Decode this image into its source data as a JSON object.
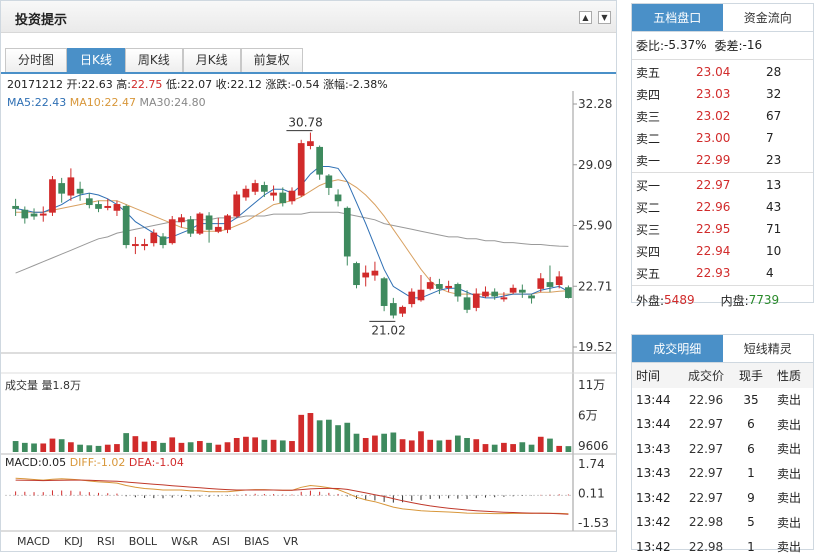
{
  "header": {
    "title": "投资提示"
  },
  "tabs": [
    "分时图",
    "日K线",
    "周K线",
    "月K线",
    "前复权"
  ],
  "info": {
    "date": "20171212",
    "open_label": "开:",
    "open": "22.63",
    "high_label": "高:",
    "high": "22.75",
    "low_label": "低:",
    "low": "22.07",
    "close_label": "收:",
    "close": "22.12",
    "change_label": "涨跌:",
    "change": "-0.54",
    "pct_label": "涨幅:",
    "pct": "-2.38%"
  },
  "ma": {
    "ma5_label": "MA5:",
    "ma5": "22.43",
    "ma10_label": "MA10:",
    "ma10": "22.47",
    "ma30_label": "MA30:",
    "ma30": "24.80"
  },
  "price_axis": [
    "32.28",
    "29.09",
    "25.90",
    "22.71",
    "19.52"
  ],
  "annotations": {
    "high": "30.78",
    "low": "21.02"
  },
  "volume": {
    "label": "成交量 量1.8万",
    "axis": [
      "11万",
      "6万",
      "9606"
    ]
  },
  "macd": {
    "macd_label": "MACD:",
    "macd": "0.05",
    "diff_label": "DIFF:",
    "diff": "-1.02",
    "dea_label": "DEA:",
    "dea": "-1.04",
    "axis": [
      "1.74",
      "0.11",
      "-1.53"
    ]
  },
  "indicators": [
    "MACD",
    "KDJ",
    "RSI",
    "BOLL",
    "W&R",
    "ASI",
    "BIAS",
    "VR"
  ],
  "chart_data": {
    "type": "candlestick",
    "ylim": [
      19.52,
      32.28
    ],
    "candles": [
      [
        26.9,
        26.8,
        27.3,
        26.4
      ],
      [
        26.7,
        26.3,
        26.9,
        26.0
      ],
      [
        26.5,
        26.4,
        26.8,
        26.2
      ],
      [
        26.5,
        26.5,
        26.9,
        26.1
      ],
      [
        26.6,
        28.3,
        28.5,
        26.4
      ],
      [
        28.1,
        27.6,
        28.4,
        27.1
      ],
      [
        27.5,
        28.4,
        28.9,
        27.2
      ],
      [
        27.8,
        27.6,
        28.2,
        27.2
      ],
      [
        27.3,
        27.0,
        27.6,
        26.8
      ],
      [
        27.0,
        26.8,
        27.2,
        26.6
      ],
      [
        26.9,
        26.9,
        27.3,
        26.7
      ],
      [
        26.7,
        27.0,
        27.2,
        26.4
      ],
      [
        26.9,
        24.9,
        27.0,
        24.7
      ],
      [
        24.9,
        24.9,
        25.3,
        24.4
      ],
      [
        24.9,
        24.9,
        25.2,
        24.6
      ],
      [
        25.0,
        25.5,
        25.7,
        24.8
      ],
      [
        25.3,
        24.9,
        25.5,
        24.7
      ],
      [
        25.0,
        26.2,
        26.4,
        24.9
      ],
      [
        26.1,
        26.3,
        26.5,
        25.8
      ],
      [
        26.2,
        25.5,
        26.4,
        25.3
      ],
      [
        25.5,
        26.5,
        26.6,
        25.4
      ],
      [
        26.4,
        25.7,
        26.6,
        25.0
      ],
      [
        25.6,
        25.8,
        26.3,
        25.5
      ],
      [
        25.7,
        26.4,
        26.5,
        25.5
      ],
      [
        26.4,
        27.5,
        27.7,
        26.3
      ],
      [
        27.4,
        27.8,
        28.0,
        27.2
      ],
      [
        27.7,
        28.1,
        28.3,
        27.5
      ],
      [
        28.0,
        27.7,
        28.2,
        27.4
      ],
      [
        27.5,
        27.6,
        28.0,
        27.2
      ],
      [
        27.6,
        27.1,
        27.9,
        26.9
      ],
      [
        27.2,
        27.7,
        27.9,
        27.0
      ],
      [
        27.5,
        30.2,
        30.4,
        27.4
      ],
      [
        30.1,
        30.3,
        30.78,
        29.9
      ],
      [
        30.0,
        28.6,
        30.1,
        28.3
      ],
      [
        28.5,
        27.9,
        28.6,
        27.5
      ],
      [
        27.5,
        27.2,
        27.8,
        26.9
      ],
      [
        26.8,
        24.3,
        26.9,
        23.8
      ],
      [
        23.9,
        22.8,
        24.0,
        22.6
      ],
      [
        23.2,
        23.4,
        23.8,
        22.7
      ],
      [
        23.3,
        23.5,
        24.0,
        23.0
      ],
      [
        23.1,
        21.7,
        23.2,
        21.4
      ],
      [
        21.8,
        21.2,
        22.1,
        21.02
      ],
      [
        21.3,
        21.6,
        21.7,
        21.1
      ],
      [
        21.8,
        22.4,
        22.6,
        21.6
      ],
      [
        22.0,
        22.5,
        23.3,
        21.9
      ],
      [
        22.6,
        22.9,
        23.2,
        22.5
      ],
      [
        22.8,
        22.6,
        23.1,
        22.3
      ],
      [
        22.7,
        22.7,
        23.0,
        22.4
      ],
      [
        22.8,
        22.2,
        22.9,
        21.9
      ],
      [
        22.1,
        21.5,
        22.5,
        21.3
      ],
      [
        21.6,
        22.3,
        22.6,
        21.4
      ],
      [
        22.2,
        22.4,
        22.7,
        22.1
      ],
      [
        22.4,
        22.2,
        22.6,
        22.0
      ],
      [
        22.1,
        22.1,
        22.4,
        21.9
      ],
      [
        22.4,
        22.6,
        22.8,
        22.3
      ],
      [
        22.5,
        22.4,
        22.8,
        22.1
      ],
      [
        22.2,
        22.1,
        22.3,
        21.8
      ],
      [
        22.6,
        23.1,
        23.4,
        22.4
      ],
      [
        22.9,
        22.7,
        23.8,
        22.4
      ],
      [
        22.8,
        23.2,
        23.5,
        22.6
      ],
      [
        22.63,
        22.12,
        22.75,
        22.07
      ]
    ],
    "volume_ylim": [
      0,
      110000
    ],
    "volume": [
      18000,
      15000,
      14000,
      14000,
      22000,
      21000,
      16000,
      12000,
      11000,
      10000,
      12000,
      13000,
      31000,
      26000,
      17000,
      18000,
      15000,
      24000,
      15000,
      16000,
      18000,
      15000,
      12000,
      16000,
      23000,
      25000,
      24000,
      20000,
      20000,
      19000,
      18000,
      61000,
      64000,
      52000,
      53000,
      44000,
      48000,
      30000,
      23000,
      27000,
      30000,
      32000,
      21000,
      19000,
      34000,
      20000,
      19000,
      20000,
      27000,
      23000,
      21000,
      13000,
      12000,
      15000,
      13000,
      16000,
      12000,
      25000,
      22000,
      10000,
      9606
    ],
    "macd_ylim": [
      -1.53,
      1.74
    ],
    "macd_hist": [
      0.22,
      0.2,
      0.18,
      0.18,
      0.28,
      0.27,
      0.26,
      0.22,
      0.18,
      0.14,
      0.12,
      0.1,
      -0.05,
      -0.1,
      -0.14,
      -0.15,
      -0.16,
      -0.12,
      -0.1,
      -0.12,
      -0.08,
      -0.08,
      -0.06,
      -0.03,
      0.04,
      0.07,
      0.09,
      0.08,
      0.07,
      0.05,
      0.05,
      0.2,
      0.26,
      0.2,
      0.14,
      0.08,
      -0.06,
      -0.2,
      -0.26,
      -0.28,
      -0.36,
      -0.4,
      -0.38,
      -0.3,
      -0.25,
      -0.2,
      -0.18,
      -0.16,
      -0.18,
      -0.2,
      -0.15,
      -0.12,
      -0.1,
      -0.08,
      -0.05,
      -0.03,
      -0.02,
      0.03,
      0.04,
      0.06,
      0.05
    ],
    "diff": [
      0.95,
      0.92,
      0.88,
      0.85,
      0.9,
      0.92,
      0.9,
      0.86,
      0.8,
      0.75,
      0.72,
      0.68,
      0.55,
      0.45,
      0.38,
      0.35,
      0.3,
      0.3,
      0.3,
      0.25,
      0.25,
      0.2,
      0.2,
      0.2,
      0.25,
      0.3,
      0.32,
      0.32,
      0.3,
      0.28,
      0.28,
      0.45,
      0.55,
      0.5,
      0.42,
      0.32,
      0.12,
      -0.1,
      -0.25,
      -0.35,
      -0.5,
      -0.65,
      -0.75,
      -0.8,
      -0.85,
      -0.88,
      -0.9,
      -0.92,
      -0.95,
      -0.98,
      -0.99,
      -1.0,
      -1.01,
      -1.01,
      -1.0,
      -1.0,
      -1.0,
      -0.98,
      -0.99,
      -1.0,
      -1.02
    ],
    "dea": [
      0.85,
      0.84,
      0.83,
      0.82,
      0.83,
      0.84,
      0.85,
      0.85,
      0.84,
      0.82,
      0.8,
      0.78,
      0.74,
      0.7,
      0.66,
      0.62,
      0.58,
      0.54,
      0.5,
      0.46,
      0.42,
      0.38,
      0.35,
      0.32,
      0.3,
      0.3,
      0.3,
      0.3,
      0.3,
      0.29,
      0.29,
      0.32,
      0.36,
      0.38,
      0.39,
      0.38,
      0.33,
      0.24,
      0.14,
      0.04,
      -0.06,
      -0.18,
      -0.3,
      -0.4,
      -0.5,
      -0.58,
      -0.65,
      -0.71,
      -0.76,
      -0.81,
      -0.85,
      -0.88,
      -0.91,
      -0.93,
      -0.95,
      -0.97,
      -0.98,
      -0.99,
      -1.0,
      -1.02,
      -1.04
    ],
    "ma5": [
      26.8,
      26.7,
      26.6,
      26.6,
      26.8,
      27.0,
      27.3,
      27.5,
      27.6,
      27.5,
      27.3,
      27.0,
      26.6,
      26.1,
      25.8,
      25.5,
      25.2,
      25.3,
      25.5,
      25.7,
      26.0,
      26.0,
      26.0,
      26.0,
      26.3,
      26.7,
      27.1,
      27.5,
      27.8,
      27.8,
      27.6,
      28.0,
      28.6,
      29.0,
      29.0,
      28.9,
      28.2,
      27.1,
      26.0,
      24.8,
      23.6,
      22.7,
      22.4,
      22.1,
      22.1,
      22.3,
      22.5,
      22.6,
      22.6,
      22.4,
      22.2,
      22.1,
      22.1,
      22.2,
      22.3,
      22.3,
      22.3,
      22.5,
      22.6,
      22.7,
      22.43
    ],
    "ma10": [
      26.6,
      26.6,
      26.6,
      26.6,
      26.7,
      26.8,
      26.9,
      27.0,
      27.1,
      27.2,
      27.2,
      27.2,
      27.0,
      26.8,
      26.6,
      26.4,
      26.2,
      26.0,
      25.8,
      25.7,
      25.6,
      25.6,
      25.6,
      25.7,
      25.9,
      26.1,
      26.4,
      26.7,
      27.0,
      27.1,
      27.2,
      27.4,
      27.7,
      28.0,
      28.2,
      28.3,
      28.2,
      27.9,
      27.5,
      27.0,
      26.4,
      25.7,
      25.0,
      24.3,
      23.6,
      23.0,
      22.6,
      22.4,
      22.3,
      22.3,
      22.3,
      22.3,
      22.3,
      22.3,
      22.3,
      22.3,
      22.3,
      22.4,
      22.4,
      22.45,
      22.47
    ],
    "ma30": [
      23.4,
      23.6,
      23.8,
      24.0,
      24.2,
      24.4,
      24.6,
      24.8,
      25.0,
      25.2,
      25.3,
      25.5,
      25.6,
      25.7,
      25.8,
      25.9,
      26.0,
      26.1,
      26.1,
      26.2,
      26.2,
      26.2,
      26.3,
      26.3,
      26.3,
      26.4,
      26.4,
      26.4,
      26.5,
      26.5,
      26.5,
      26.5,
      26.6,
      26.6,
      26.6,
      26.6,
      26.5,
      26.4,
      26.3,
      26.2,
      26.0,
      25.9,
      25.8,
      25.7,
      25.6,
      25.5,
      25.4,
      25.3,
      25.3,
      25.2,
      25.2,
      25.1,
      25.1,
      25.0,
      25.0,
      24.95,
      24.9,
      24.9,
      24.85,
      24.82,
      24.8
    ]
  },
  "orderbook": {
    "tabs": [
      "五档盘口",
      "资金流向"
    ],
    "ratio_label": "委比:",
    "ratio": "-5.37%",
    "diff_label": "委差:",
    "diff": "-16",
    "asks": [
      {
        "label": "卖五",
        "price": "23.04",
        "vol": "28"
      },
      {
        "label": "卖四",
        "price": "23.03",
        "vol": "32"
      },
      {
        "label": "卖三",
        "price": "23.02",
        "vol": "67"
      },
      {
        "label": "卖二",
        "price": "23.00",
        "vol": "7"
      },
      {
        "label": "卖一",
        "price": "22.99",
        "vol": "23"
      }
    ],
    "bids": [
      {
        "label": "买一",
        "price": "22.97",
        "vol": "13"
      },
      {
        "label": "买二",
        "price": "22.96",
        "vol": "43"
      },
      {
        "label": "买三",
        "price": "22.95",
        "vol": "71"
      },
      {
        "label": "买四",
        "price": "22.94",
        "vol": "10"
      },
      {
        "label": "买五",
        "price": "22.93",
        "vol": "4"
      }
    ],
    "outer_label": "外盘:",
    "outer": "5489",
    "inner_label": "内盘:",
    "inner": "7739"
  },
  "trades": {
    "tabs": [
      "成交明细",
      "短线精灵"
    ],
    "headers": [
      "时间",
      "成交价",
      "现手",
      "性质"
    ],
    "rows": [
      {
        "time": "13:44",
        "price": "22.96",
        "vol": "35",
        "type": "卖出"
      },
      {
        "time": "13:44",
        "price": "22.97",
        "vol": "6",
        "type": "卖出"
      },
      {
        "time": "13:43",
        "price": "22.97",
        "vol": "6",
        "type": "卖出"
      },
      {
        "time": "13:43",
        "price": "22.97",
        "vol": "1",
        "type": "卖出"
      },
      {
        "time": "13:42",
        "price": "22.97",
        "vol": "9",
        "type": "卖出"
      },
      {
        "time": "13:42",
        "price": "22.98",
        "vol": "5",
        "type": "卖出"
      },
      {
        "time": "13:42",
        "price": "22.98",
        "vol": "1",
        "type": "卖出"
      }
    ]
  },
  "colors": {
    "up": "#d12b2b",
    "down": "#3e8a5e",
    "accent": "#4a90c8"
  }
}
